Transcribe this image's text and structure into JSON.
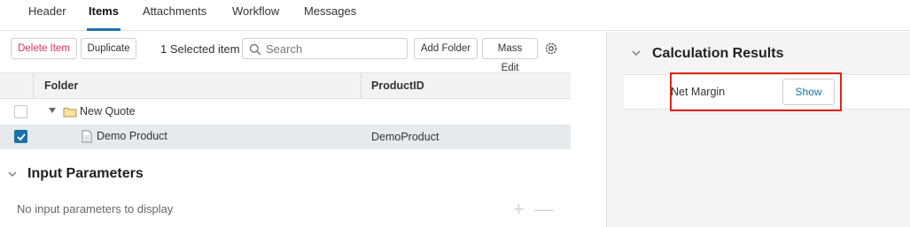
{
  "tabs": [
    "Header",
    "Items",
    "Attachments",
    "Workflow",
    "Messages"
  ],
  "active_tab": "Items",
  "toolbar": {
    "delete_label": "Delete Item",
    "duplicate_label": "Duplicate",
    "selected_count": "1 Selected item",
    "search_placeholder": "Search",
    "add_folder_label": "Add Folder",
    "mass_edit_label": "Mass Edit"
  },
  "grid": {
    "columns": [
      "Folder",
      "ProductID"
    ],
    "rows": [
      {
        "name": "New Quote",
        "product_id": "",
        "checked": false,
        "type": "folder"
      },
      {
        "name": "Demo Product",
        "product_id": "DemoProduct",
        "checked": true,
        "type": "file"
      }
    ]
  },
  "input_parameters": {
    "title": "Input Parameters",
    "empty_text": "No input parameters to display",
    "add_symbol": "+",
    "remove_symbol": "—"
  },
  "calculation_results": {
    "title": "Calculation Results",
    "items": [
      {
        "label": "Net Margin",
        "action": "Show"
      }
    ]
  },
  "colors": {
    "accent": "#1a73a8",
    "danger": "#d0306b",
    "highlight": "#e0241b"
  }
}
